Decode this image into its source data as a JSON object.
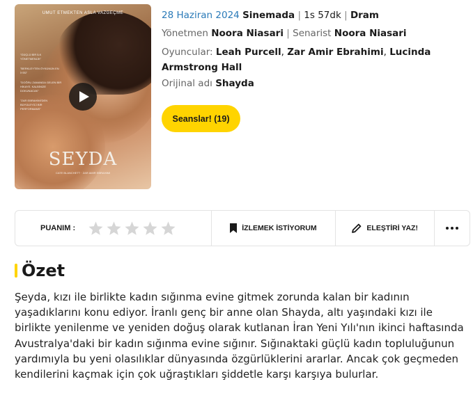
{
  "poster": {
    "tagline": "UMUT ETMEKTEN ASLA VAZGEÇME",
    "title": "SEYDA",
    "quotes": [
      "\"GÜÇLÜ BİR İLK YÖNETMENLİK\"",
      "\"BERKLEYTEN ÖYKÜNÜN EN İYİSİ\"",
      "\"DOĞRU ZAMANDA GELEN BİR HİKAYE. KALBİNİZE DOKUNACAK\"",
      "\"ZAR EBRAHİMİ'DEN BÜYÜLEYİCİ BİR PERFORMANS\""
    ],
    "credits_line": "CATE BLANCHETT · ZAR AMIR EBRAHIMI"
  },
  "meta": {
    "date": "28 Haziran 2024",
    "status": "Sinemada",
    "duration": "1s 57dk",
    "genre": "Dram",
    "director_label": "Yönetmen",
    "director": "Noora Niasari",
    "writer_label": "Senarist",
    "writer": "Noora Niasari",
    "cast_label": "Oyuncular:",
    "cast": [
      "Leah Purcell",
      "Zar Amir Ebrahimi",
      "Lucinda Armstrong Hall"
    ],
    "original_label": "Orijinal adı",
    "original_title": "Shayda",
    "pipe": "|",
    "comma": ","
  },
  "actions": {
    "showtimes_label": "Seanslar! (19)",
    "rating_label": "PUANIM :",
    "watchlist_label": "İZLEMEK İSTİYORUM",
    "review_label": "ELEŞTİRİ YAZ!"
  },
  "rating": {
    "value": 0,
    "max": 5
  },
  "summary": {
    "heading": "Özet",
    "text": "Şeyda, kızı ile birlikte kadın sığınma evine gitmek zorunda kalan bir kadının yaşadıklarını konu ediyor. İranlı genç bir anne olan Shayda, altı yaşındaki kızı ile birlikte yenilenme ve yeniden doğuş olarak kutlanan İran Yeni Yılı'nın ikinci haftasında Avustralya'daki bir kadın sığınma evine sığınır. Sığınaktaki güçlü kadın topluluğunun yardımıyla bu yeni olasılıklar dünyasında özgürlüklerini ararlar. Ancak çok geçmeden kendilerini kaçmak için çok uğraştıkları şiddetle karşı karşıya bulurlar."
  },
  "colors": {
    "accent": "#ffd400",
    "link": "#2a7ab8",
    "star_empty": "#d6d6d6"
  }
}
